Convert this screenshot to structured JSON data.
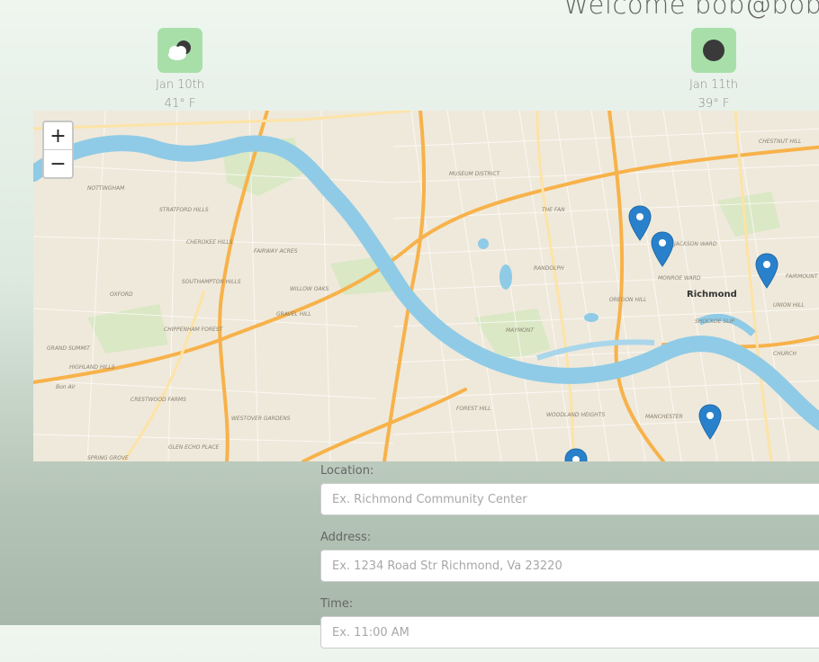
{
  "header": {
    "welcome": "Welcome bob@bob.c"
  },
  "weather": [
    {
      "date": "Jan 10th",
      "temp": "41° F",
      "icon": "partly-cloudy-icon"
    },
    {
      "date": "Jan 11th",
      "temp": "39° F",
      "icon": "clear-night-icon"
    }
  ],
  "map": {
    "zoom_in": "+",
    "zoom_out": "−",
    "city_label": "Richmond",
    "place_labels": [
      "NOTTINGHAM",
      "STRATFORD HILLS",
      "CHEROKEE HILLS",
      "FAIRWAY ACRES",
      "OXFORD",
      "WILLOW OAKS",
      "SOUTHAMPTON HILLS",
      "CHIPPENHAM FOREST",
      "GRAVEL HILL",
      "GRAND SUMMIT",
      "HIGHLAND HILLS",
      "Bon Air",
      "CRESTWOOD FARMS",
      "WESTOVER GARDENS",
      "FOREST HILL",
      "WOODLAND HEIGHTS",
      "MANCHESTER",
      "MONROE WARD",
      "OREGON HILL",
      "RANDOLPH",
      "THE FAN",
      "MUSEUM DISTRICT",
      "SHOCKOE SLIP",
      "UNION HILL",
      "CHURCH",
      "MAYMONT",
      "SPRING GROVE",
      "GLEN ECHO PLACE",
      "JACKSON WARD",
      "FAIRMOUNT",
      "CHESTNUT HILL"
    ]
  },
  "form": {
    "location_label": "Location:",
    "location_placeholder": "Ex. Richmond Community Center",
    "address_label": "Address:",
    "address_placeholder": "Ex. 1234 Road Str Richmond, Va 23220",
    "time_label": "Time:",
    "time_placeholder": "Ex. 11:00 AM"
  },
  "colors": {
    "tile_green": "#a8dfa9",
    "marker": "#2a81cb",
    "river": "#8fcbe6",
    "highway": "#f7b24a"
  }
}
